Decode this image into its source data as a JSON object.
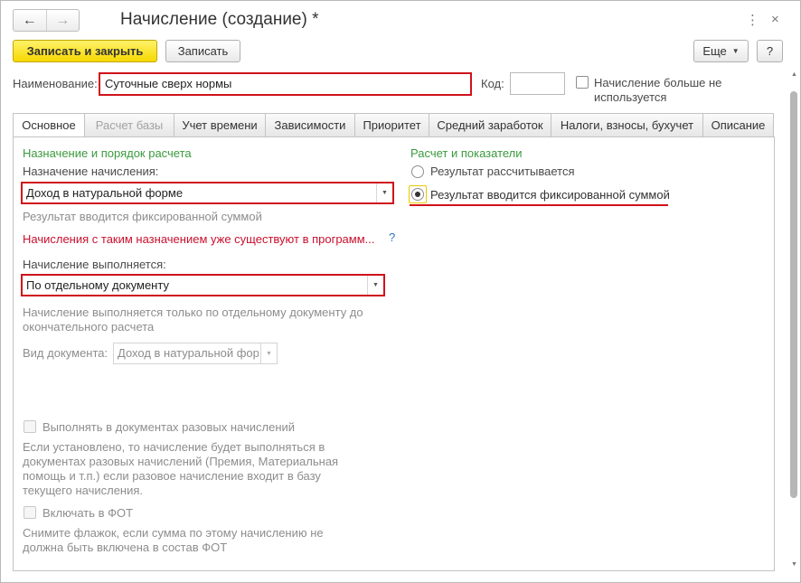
{
  "window": {
    "title": "Начисление (создание) *",
    "nav": {
      "back_icon": "←",
      "forward_icon": "→"
    },
    "more_icon": "⋮",
    "close_icon": "×"
  },
  "toolbar": {
    "save_close_label": "Записать и закрыть",
    "save_label": "Записать",
    "more_label": "Еще",
    "help_label": "?"
  },
  "fields": {
    "name_label": "Наименование:",
    "name_value": "Суточные сверх нормы",
    "code_label": "Код:",
    "code_value": "",
    "not_used_label_1": "Начисление больше не",
    "not_used_label_2": "используется",
    "not_used_checked": false
  },
  "tabs": [
    {
      "label": "Основное",
      "state": "active"
    },
    {
      "label": "Расчет базы",
      "state": "disabled"
    },
    {
      "label": "Учет времени",
      "state": "normal"
    },
    {
      "label": "Зависимости",
      "state": "normal"
    },
    {
      "label": "Приоритет",
      "state": "normal"
    },
    {
      "label": "Средний заработок",
      "state": "normal"
    },
    {
      "label": "Налоги, взносы, бухучет",
      "state": "normal"
    },
    {
      "label": "Описание",
      "state": "normal"
    }
  ],
  "left": {
    "section_title": "Назначение и порядок расчета",
    "purpose_label": "Назначение начисления:",
    "purpose_value": "Доход в натуральной форме",
    "purpose_hint": "Результат вводится фиксированной суммой",
    "warning": "Начисления с таким назначением уже существуют в программ...",
    "warning_help": "?",
    "performed_label": "Начисление выполняется:",
    "performed_value": "По отдельному документу",
    "performed_hint_1": "Начисление выполняется только по отдельному документу до",
    "performed_hint_2": "окончательного расчета",
    "doc_type_label": "Вид документа:",
    "doc_type_value": "Доход в натуральной фор",
    "one_time_label": "Выполнять в документах разовых начислений",
    "one_time_hint": [
      "Если установлено, то начисление будет выполняться в",
      "документах разовых начислений (Премия, Материальная",
      "помощь и т.п.) если разовое начисление входит в базу",
      "текущего начисления."
    ],
    "fot_label": "Включать в ФОТ",
    "fot_hint": [
      "Снимите флажок, если сумма по этому начислению не",
      "должна быть включена в состав ФОТ"
    ]
  },
  "right": {
    "section_title": "Расчет и показатели",
    "options": [
      {
        "label": "Результат рассчитывается",
        "selected": false
      },
      {
        "label": "Результат вводится фиксированной суммой",
        "selected": true
      }
    ]
  },
  "colors": {
    "highlight": "#d0121b",
    "section_title": "#3b9a3e",
    "warning": "#c8102e",
    "primary_button": "#f6d800"
  }
}
